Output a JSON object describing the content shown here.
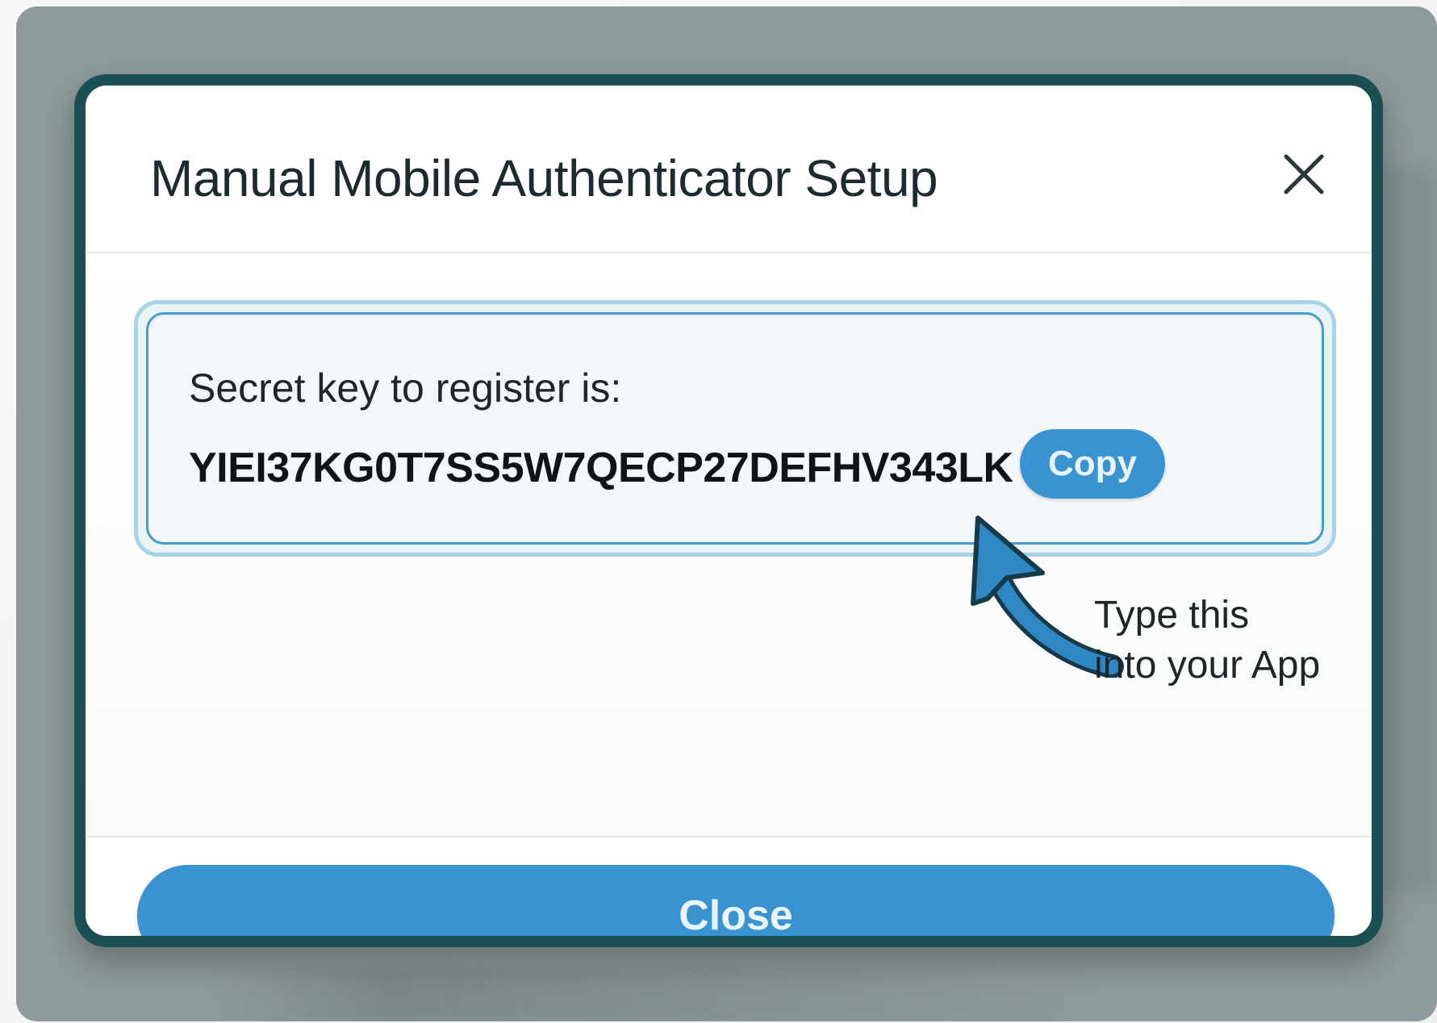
{
  "dialog": {
    "title": "Manual Mobile Authenticator Setup",
    "close_icon": "close-icon"
  },
  "secret": {
    "label": "Secret key to register is:",
    "key": "YIEI37KG0T7SS5W7QECP27DEFHV343LK",
    "copy_label": "Copy"
  },
  "hint": {
    "line1": "Type this",
    "line2": "into your App",
    "arrow_icon": "curved-arrow-icon"
  },
  "footer": {
    "close_label": "Close"
  },
  "colors": {
    "accent": "#3a93d1",
    "dialog_border": "#1a4f54",
    "backdrop": "#8e9a9b",
    "secret_box_border": "#4a9cc8",
    "arrow": "#2f88c4"
  }
}
